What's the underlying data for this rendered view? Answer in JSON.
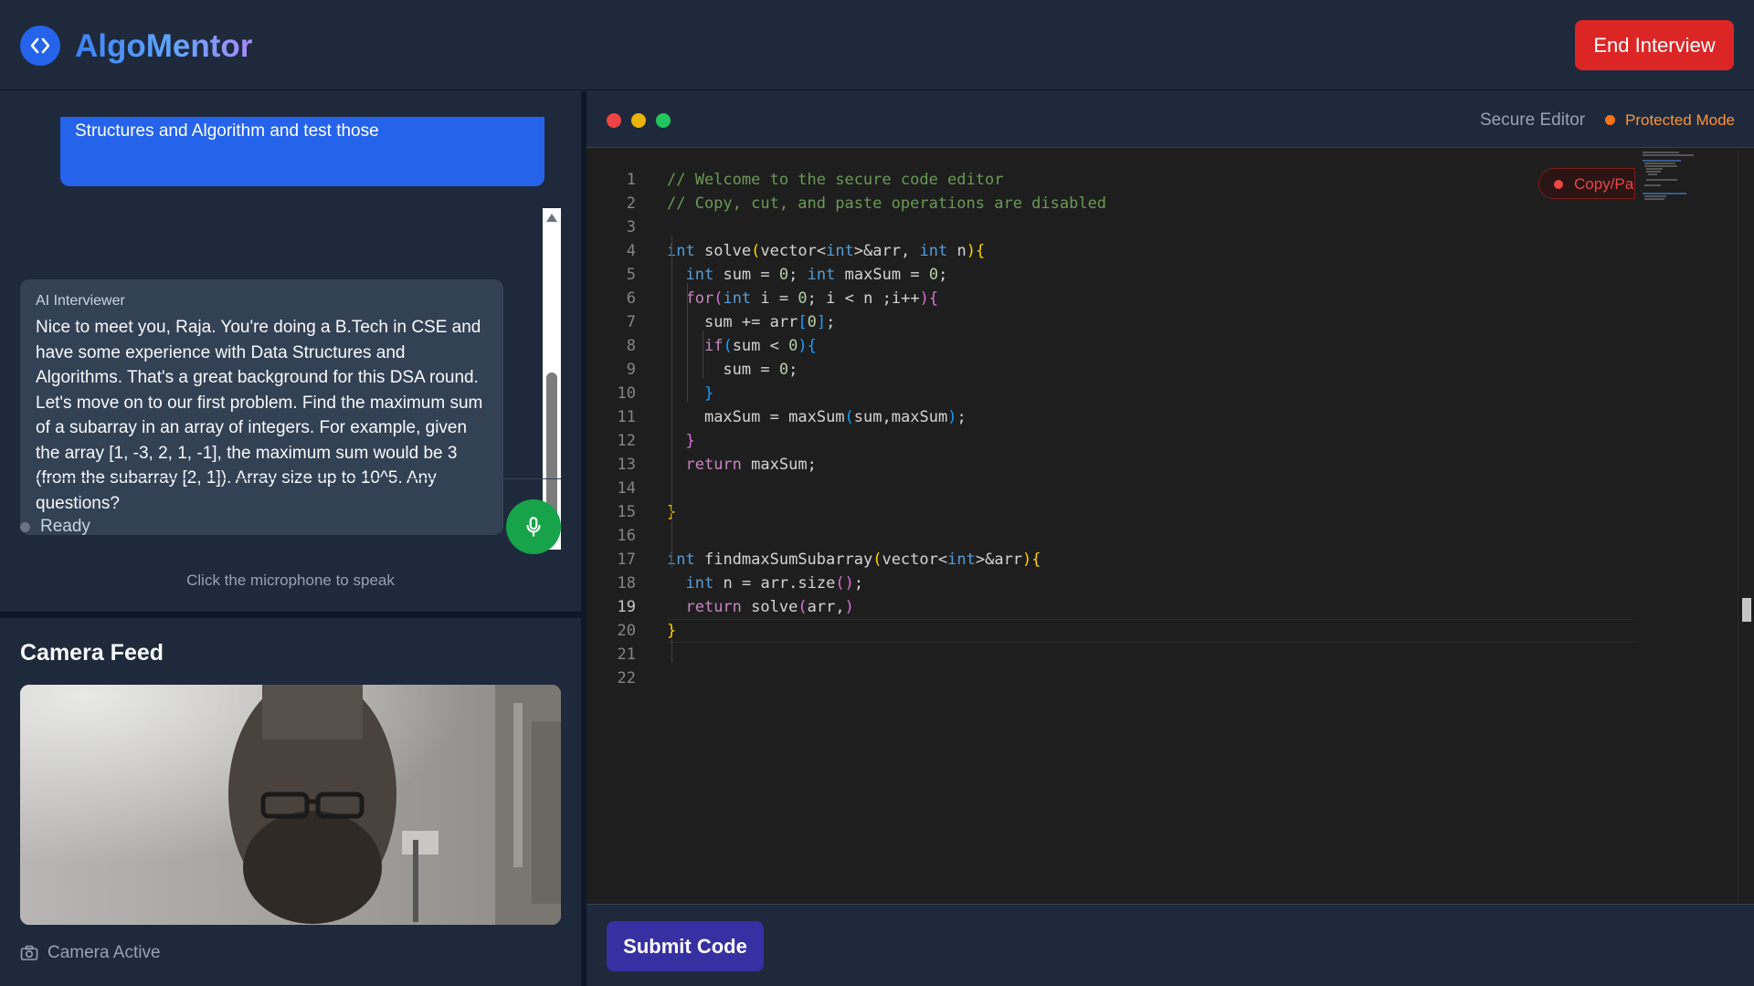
{
  "header": {
    "app_title": "AlgoMentor",
    "end_button": "End Interview"
  },
  "chat": {
    "messages": [
      {
        "role": "user",
        "text": "Engineering and I have a little bit experience of Data Structures and Algorithm and test those"
      },
      {
        "role": "ai",
        "sender": "AI Interviewer",
        "text": "Nice to meet you, Raja. You're doing a B.Tech in CSE and have some experience with Data Structures and Algorithms. That's a great background for this DSA round. Let's move on to our first problem. Find the maximum sum of a subarray in an array of integers. For example, given the array [1, -3, 2, 1, -1], the maximum sum would be 3 (from the subarray [2, 1]). Array size up to 10^5. Any questions?"
      }
    ],
    "status": "Ready",
    "mic_hint": "Click the microphone to speak"
  },
  "camera": {
    "title": "Camera Feed",
    "status": "Camera Active"
  },
  "editor": {
    "title": "Secure Editor",
    "mode": "Protected Mode",
    "copy_badge": "Copy/Pa",
    "current_line": 19,
    "line_numbers": [
      "1",
      "2",
      "3",
      "4",
      "5",
      "6",
      "7",
      "8",
      "9",
      "10",
      "11",
      "12",
      "13",
      "14",
      "15",
      "16",
      "17",
      "18",
      "19",
      "20",
      "21",
      "22"
    ],
    "code_lines": [
      "// Welcome to the secure code editor",
      "// Copy, cut, and paste operations are disabled",
      "",
      "int solve(vector<int>&arr, int n){",
      "  int sum = 0; int maxSum = 0;",
      "  for(int i = 0; i < n ;i++){",
      "    sum += arr[0];",
      "    if(sum < 0){",
      "      sum = 0;",
      "    }",
      "    maxSum = maxSum(sum,maxSum);",
      "  }",
      "  return maxSum;",
      "",
      "}",
      "",
      "int findmaxSumSubarray(vector<int>&arr){",
      "  int n = arr.size();",
      "  return solve(arr,)",
      "}",
      "",
      ""
    ],
    "submit_button": "Submit Code"
  },
  "colors": {
    "accent": "#2563eb",
    "danger": "#dc2626",
    "mic": "#16a34a",
    "submit": "#3730a3",
    "protected": "#f97316"
  },
  "icons": [
    "code-brackets-icon",
    "microphone-icon",
    "camera-icon"
  ]
}
